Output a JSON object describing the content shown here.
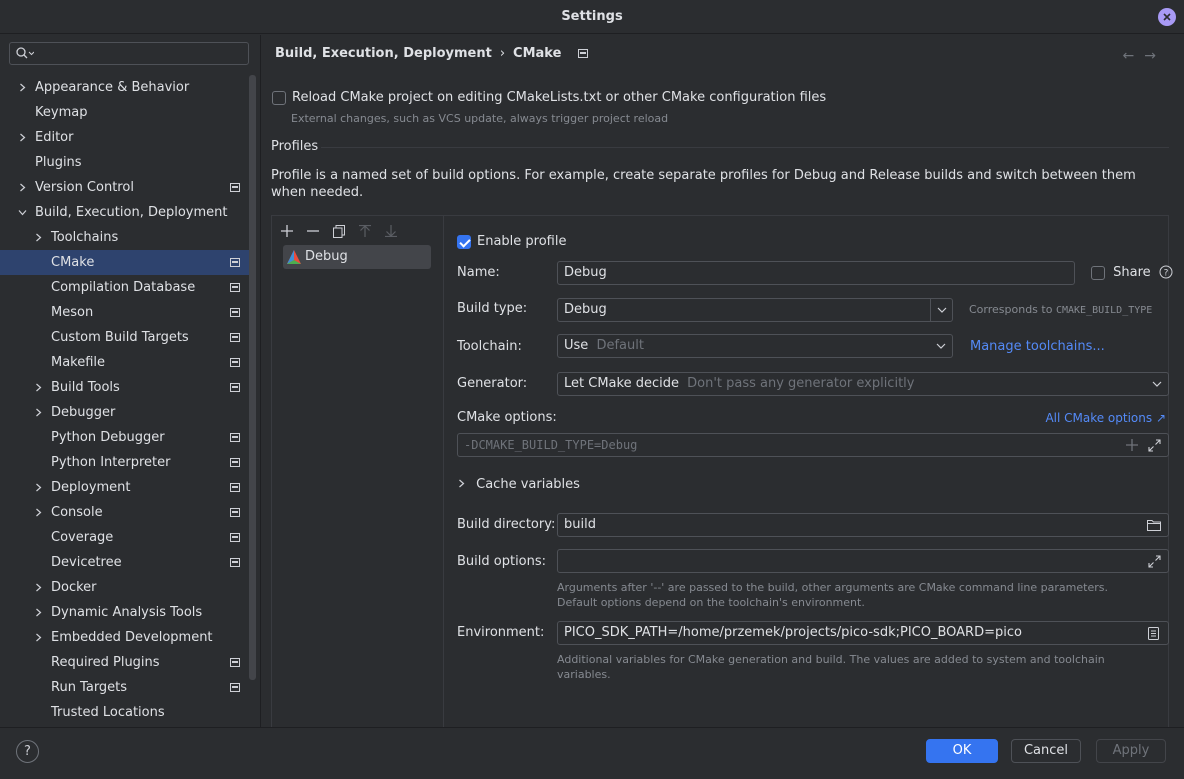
{
  "window": {
    "title": "Settings"
  },
  "search": {
    "placeholder": ""
  },
  "sidebar": {
    "items": [
      {
        "label": "Appearance & Behavior"
      },
      {
        "label": "Keymap"
      },
      {
        "label": "Editor"
      },
      {
        "label": "Plugins"
      },
      {
        "label": "Version Control"
      },
      {
        "label": "Build, Execution, Deployment"
      },
      {
        "label": "Toolchains"
      },
      {
        "label": "CMake"
      },
      {
        "label": "Compilation Database"
      },
      {
        "label": "Meson"
      },
      {
        "label": "Custom Build Targets"
      },
      {
        "label": "Makefile"
      },
      {
        "label": "Build Tools"
      },
      {
        "label": "Debugger"
      },
      {
        "label": "Python Debugger"
      },
      {
        "label": "Python Interpreter"
      },
      {
        "label": "Deployment"
      },
      {
        "label": "Console"
      },
      {
        "label": "Coverage"
      },
      {
        "label": "Devicetree"
      },
      {
        "label": "Docker"
      },
      {
        "label": "Dynamic Analysis Tools"
      },
      {
        "label": "Embedded Development"
      },
      {
        "label": "Required Plugins"
      },
      {
        "label": "Run Targets"
      },
      {
        "label": "Trusted Locations"
      }
    ]
  },
  "breadcrumb": {
    "parent": "Build, Execution, Deployment",
    "separator": "›",
    "current": "CMake"
  },
  "nav": {
    "back": "←",
    "forward": "→"
  },
  "reload": {
    "label": "Reload CMake project on editing CMakeLists.txt or other CMake configuration files",
    "hint": "External changes, such as VCS update, always trigger project reload",
    "checked": false
  },
  "profiles": {
    "title": "Profiles",
    "description": "Profile is a named set of build options. For example, create separate profiles for Debug and Release builds and switch between them when needed.",
    "list": [
      {
        "name": "Debug"
      }
    ]
  },
  "form": {
    "enable_label": "Enable profile",
    "enabled": true,
    "name_label": "Name:",
    "name_value": "Debug",
    "share_label": "Share",
    "build_type_label": "Build type:",
    "build_type_value": "Debug",
    "build_type_hint": "Corresponds to",
    "build_type_hint_code": "CMAKE_BUILD_TYPE",
    "toolchain_label": "Toolchain:",
    "toolchain_use": "Use",
    "toolchain_value": "Default",
    "manage_toolchains": "Manage toolchains...",
    "generator_label": "Generator:",
    "generator_value": "Let CMake decide",
    "generator_hint": "Don't pass any generator explicitly",
    "cmake_options_label": "CMake options:",
    "all_cmake_options": "All CMake options ↗",
    "cmake_options_value": "-DCMAKE_BUILD_TYPE=Debug",
    "cache_variables": "Cache variables",
    "build_dir_label": "Build directory:",
    "build_dir_value": "build",
    "build_options_label": "Build options:",
    "build_options_value": "",
    "build_options_hint1": "Arguments after '--' are passed to the build, other arguments are CMake command line parameters.",
    "build_options_hint2": "Default options depend on the toolchain's environment.",
    "environment_label": "Environment:",
    "environment_value": "PICO_SDK_PATH=/home/przemek/projects/pico-sdk;PICO_BOARD=pico",
    "environment_hint1": "Additional variables for CMake generation and build. The values are added to system and toolchain",
    "environment_hint2": "variables."
  },
  "buttons": {
    "help": "?",
    "ok": "OK",
    "cancel": "Cancel",
    "apply": "Apply"
  },
  "colors": {
    "accent": "#3574f0",
    "link": "#548af7",
    "selection": "#2e436e",
    "background": "#2b2d30"
  }
}
